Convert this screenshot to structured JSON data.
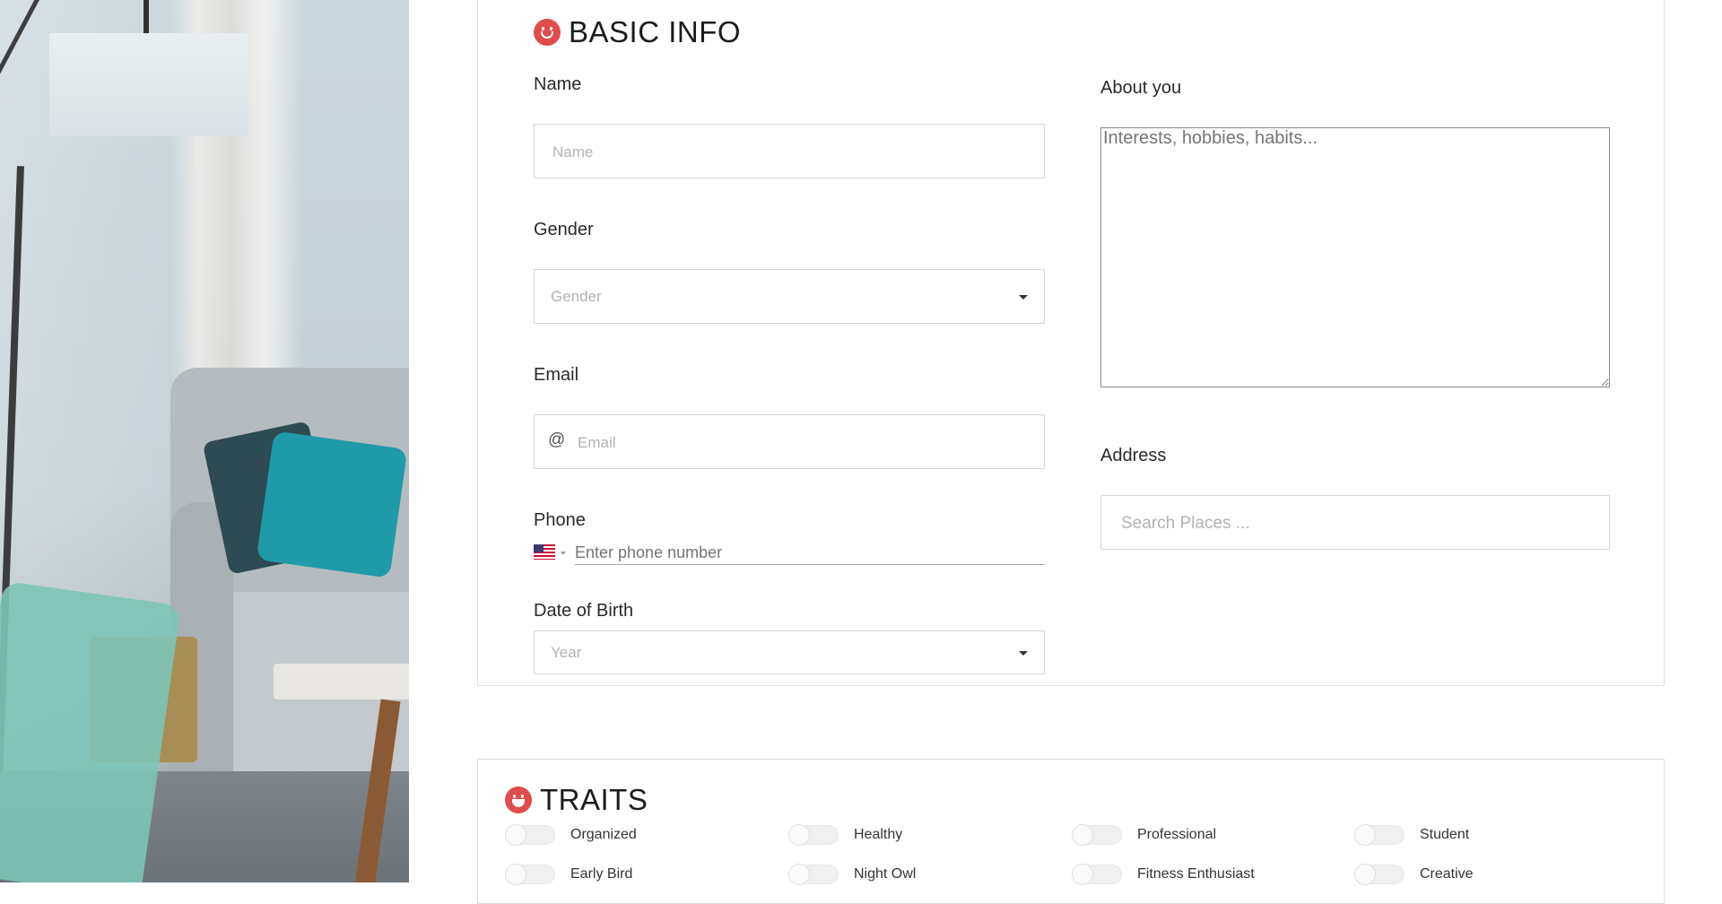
{
  "basic_info": {
    "title": "BASIC INFO",
    "name": {
      "label": "Name",
      "placeholder": "Name",
      "value": ""
    },
    "gender": {
      "label": "Gender",
      "placeholder": "Gender"
    },
    "email": {
      "label": "Email",
      "placeholder": "Email",
      "icon": "at-sign-icon",
      "icon_char": "@"
    },
    "phone": {
      "label": "Phone",
      "placeholder": "Enter phone number",
      "country_flag": "us-flag-icon"
    },
    "dob": {
      "label": "Date of Birth",
      "placeholder": "Year"
    },
    "about": {
      "label": "About you",
      "placeholder": "Interests, hobbies, habits..."
    },
    "address": {
      "label": "Address",
      "placeholder": "Search Places ..."
    }
  },
  "traits": {
    "title": "TRAITS",
    "items": [
      {
        "label": "Organized",
        "on": false
      },
      {
        "label": "Healthy",
        "on": false
      },
      {
        "label": "Professional",
        "on": false
      },
      {
        "label": "Student",
        "on": false
      },
      {
        "label": "Early Bird",
        "on": false
      },
      {
        "label": "Night Owl",
        "on": false
      },
      {
        "label": "Fitness Enthusiast",
        "on": false
      },
      {
        "label": "Creative",
        "on": false
      }
    ]
  },
  "colors": {
    "accent_red": "#e04b4b",
    "border": "#d6d6d6",
    "placeholder": "#b3b3b3"
  }
}
